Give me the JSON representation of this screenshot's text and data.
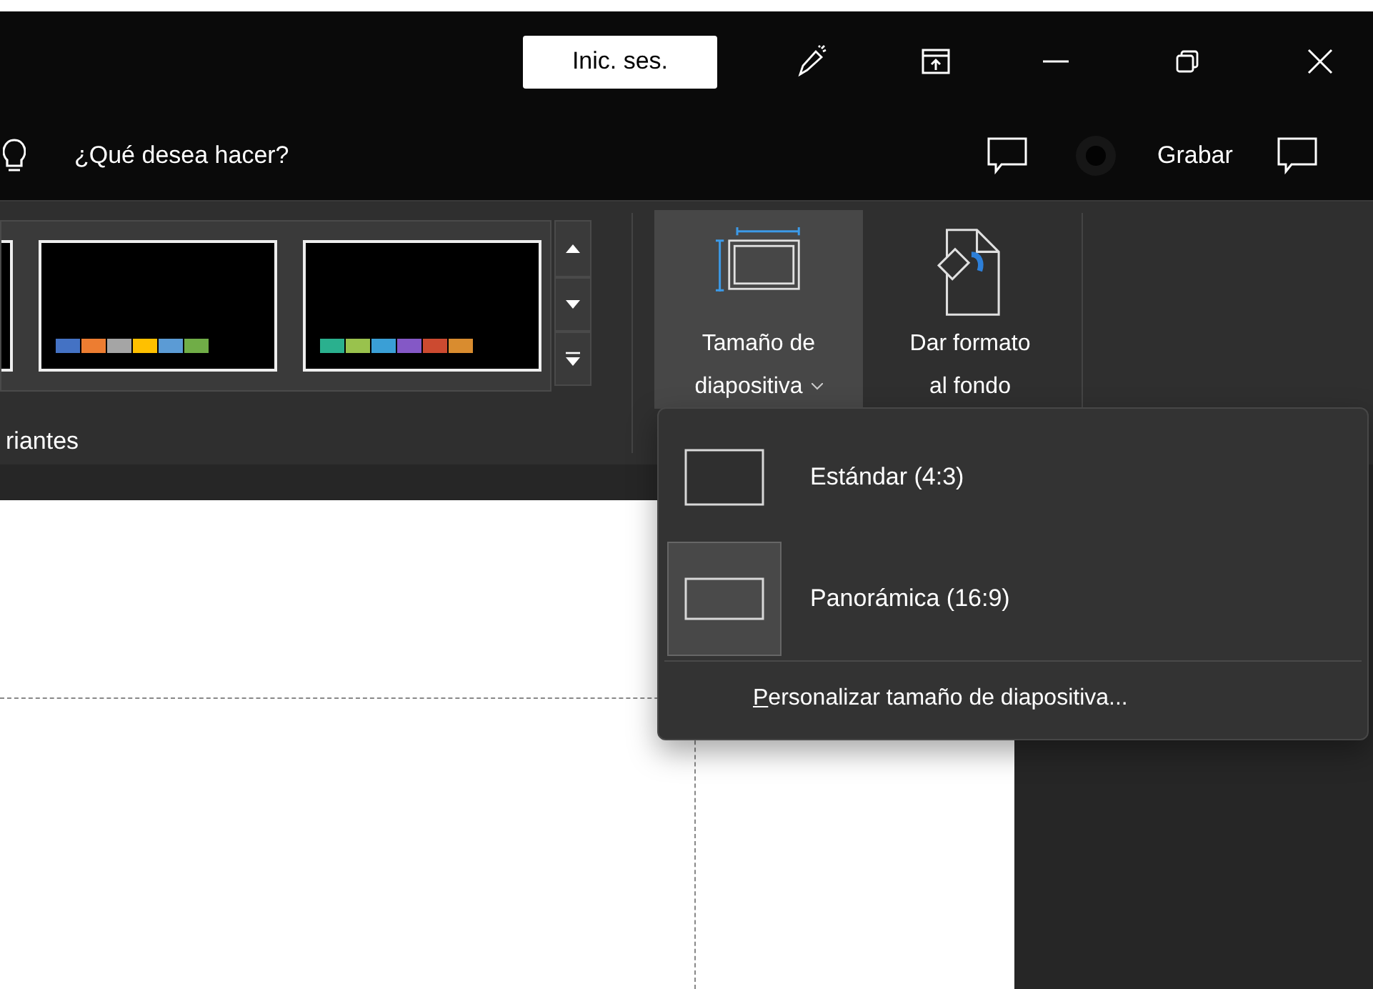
{
  "title_bar": {
    "sign_in_button": "Inic. ses."
  },
  "command_bar": {
    "search": {
      "placeholder": "¿Qué desea hacer?"
    },
    "record_button": "Grabar"
  },
  "ribbon": {
    "variants_group": {
      "label": "riantes",
      "themes": [
        {
          "swatches": [
            {
              "color": "#4472c4"
            },
            {
              "color": "#ed7d31"
            },
            {
              "color": "#a5a5a5"
            },
            {
              "color": "#ffc000"
            },
            {
              "color": "#5b9bd5"
            },
            {
              "color": "#70ad47"
            }
          ]
        },
        {
          "swatches": [
            {
              "color": "#2ab08e"
            },
            {
              "color": "#99c24d"
            },
            {
              "color": "#3a9fd6"
            },
            {
              "color": "#8458c6"
            },
            {
              "color": "#cc4a30"
            },
            {
              "color": "#d98c2f"
            }
          ]
        }
      ]
    },
    "buttons": [
      {
        "kind": "slide-size",
        "label_lines": [
          "Tamaño de",
          "diapositiva"
        ],
        "has_dropdown": true,
        "expanded": true
      },
      {
        "kind": "background",
        "label_lines": [
          "Dar formato",
          "al fondo"
        ],
        "has_dropdown": false,
        "expanded": false
      }
    ]
  },
  "dropdown_menu": {
    "items": [
      {
        "kind": "standard",
        "label": "Estándar (4:3)",
        "selected": false
      },
      {
        "kind": "widescreen",
        "label": "Panorámica (16:9)",
        "selected": true
      }
    ],
    "footer_item": {
      "label": "Personalizar tamaño de diapositiva...",
      "mnemonic_underlined": true
    }
  }
}
